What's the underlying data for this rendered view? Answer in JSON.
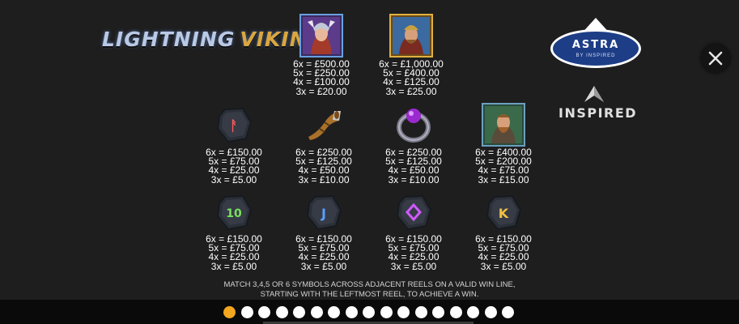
{
  "logo": {
    "word1": "LIGHTNING",
    "word2": "VIKING"
  },
  "provider": {
    "astra": "ASTRA",
    "astra_sub": "BY INSPIRED",
    "inspired": "INSPIRED"
  },
  "close_label": "X",
  "symbols": [
    {
      "name": "valkyrie",
      "pays": [
        "6x = £500.00",
        "5x = £250.00",
        "4x = £100.00",
        "3x = £20.00"
      ]
    },
    {
      "name": "viking-king",
      "pays": [
        "6x = £1,000.00",
        "5x = £400.00",
        "4x = £125.00",
        "3x = £25.00"
      ]
    },
    {
      "name": "rune-a",
      "pays": [
        "6x = £150.00",
        "5x = £75.00",
        "4x = £25.00",
        "3x = £5.00"
      ]
    },
    {
      "name": "drinking-horn",
      "pays": [
        "6x = £250.00",
        "5x = £125.00",
        "4x = £50.00",
        "3x = £10.00"
      ]
    },
    {
      "name": "ring",
      "pays": [
        "6x = £250.00",
        "5x = £125.00",
        "4x = £50.00",
        "3x = £10.00"
      ]
    },
    {
      "name": "viking-warrior",
      "pays": [
        "6x = £400.00",
        "5x = £200.00",
        "4x = £75.00",
        "3x = £15.00"
      ]
    },
    {
      "name": "rune-10",
      "pays": [
        "6x = £150.00",
        "5x = £75.00",
        "4x = £25.00",
        "3x = £5.00"
      ]
    },
    {
      "name": "rune-j",
      "pays": [
        "6x = £150.00",
        "5x = £75.00",
        "4x = £25.00",
        "3x = £5.00"
      ]
    },
    {
      "name": "rune-q",
      "pays": [
        "6x = £150.00",
        "5x = £75.00",
        "4x = £25.00",
        "3x = £5.00"
      ]
    },
    {
      "name": "rune-k",
      "pays": [
        "6x = £150.00",
        "5x = £75.00",
        "4x = £25.00",
        "3x = £5.00"
      ]
    }
  ],
  "rules": {
    "line1": "MATCH 3,4,5 OR 6 SYMBOLS ACROSS ADJACENT REELS ON A VALID WIN LINE,",
    "line2": "STARTING WITH THE LEFTMOST REEL, TO ACHIEVE A WIN."
  },
  "pagination": {
    "total_pages": 17,
    "current_page": 1,
    "active_color": "#f3a71f"
  }
}
